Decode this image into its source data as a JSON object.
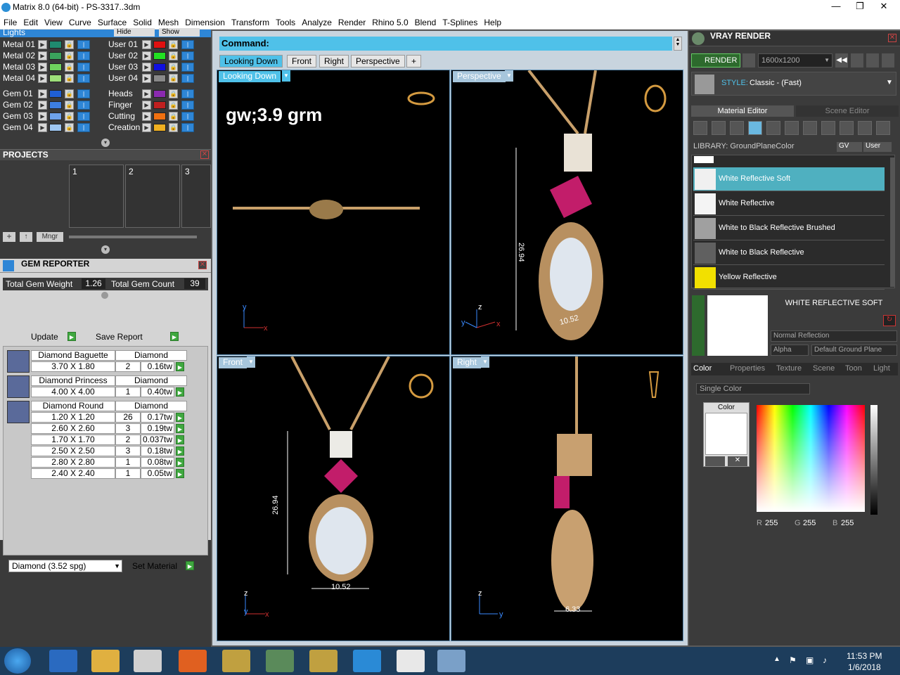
{
  "window": {
    "title": "Matrix 8.0 (64-bit) - PS-3317..3dm",
    "min": "—",
    "max": "❐",
    "close": "✕"
  },
  "menu": [
    "File",
    "Edit",
    "View",
    "Curve",
    "Surface",
    "Solid",
    "Mesh",
    "Dimension",
    "Transform",
    "Tools",
    "Analyze",
    "Render",
    "Rhino 5.0",
    "Blend",
    "T-Splines",
    "Help"
  ],
  "layers": {
    "top_label": "Lights",
    "hide": "Hide",
    "show": "Show",
    "left": [
      {
        "name": "Metal 01",
        "color": "#1f8a6f"
      },
      {
        "name": "Metal 02",
        "color": "#3aa35c"
      },
      {
        "name": "Metal 03",
        "color": "#6fd35e"
      },
      {
        "name": "Metal 04",
        "color": "#9ee07a"
      },
      {
        "name": "Gem 01",
        "color": "#1f5fd6"
      },
      {
        "name": "Gem 02",
        "color": "#3d7ee0"
      },
      {
        "name": "Gem 03",
        "color": "#6ea2ea"
      },
      {
        "name": "Gem 04",
        "color": "#9ec6f2"
      }
    ],
    "right": [
      {
        "name": "User 01",
        "color": "#e01010"
      },
      {
        "name": "User 02",
        "color": "#22e022"
      },
      {
        "name": "User 03",
        "color": "#1010e0"
      },
      {
        "name": "User 04",
        "color": "#888888"
      },
      {
        "name": "Heads",
        "color": "#8a2ab0"
      },
      {
        "name": "Finger",
        "color": "#c02020"
      },
      {
        "name": "Cutting",
        "color": "#f07010"
      },
      {
        "name": "Creation",
        "color": "#f0b020"
      }
    ]
  },
  "projects": {
    "title": "PROJECTS",
    "slots": [
      "1",
      "2",
      "3"
    ],
    "mngr": "Mngr"
  },
  "gem_reporter": {
    "title": "GEM REPORTER",
    "total_weight_label": "Total Gem Weight",
    "total_weight": "1.26",
    "total_count_label": "Total Gem Count",
    "total_count": "39",
    "update": "Update",
    "save": "Save Report",
    "groups": [
      {
        "cut": "Diamond Baguette",
        "mat": "Diamond",
        "rows": [
          [
            "3.70 X 1.80",
            "2",
            "0.16tw"
          ]
        ]
      },
      {
        "cut": "Diamond Princess",
        "mat": "Diamond",
        "rows": [
          [
            "4.00 X 4.00",
            "1",
            "0.40tw"
          ]
        ]
      },
      {
        "cut": "Diamond Round",
        "mat": "Diamond",
        "rows": [
          [
            "1.20 X 1.20",
            "26",
            "0.17tw"
          ],
          [
            "2.60 X 2.60",
            "3",
            "0.19tw"
          ],
          [
            "1.70 X 1.70",
            "2",
            "0.037tw"
          ],
          [
            "2.50 X 2.50",
            "3",
            "0.18tw"
          ],
          [
            "2.80 X 2.80",
            "1",
            "0.08tw"
          ],
          [
            "2.40 X 2.40",
            "1",
            "0.05tw"
          ]
        ]
      }
    ],
    "material_select": "Diamond     (3.52 spg)",
    "set_material": "Set Material"
  },
  "command": {
    "label": "Command:"
  },
  "view_tabs": [
    "Looking Down",
    "Front",
    "Right",
    "Perspective",
    "+"
  ],
  "viewports": {
    "top_left": {
      "label": "Looking Down",
      "note": "gw;3.9 grm"
    },
    "top_right": {
      "label": "Perspective",
      "dim1": "26.94",
      "dim2": "10.52"
    },
    "bottom_left": {
      "label": "Front",
      "dim1": "26.94",
      "dim2": "10.52"
    },
    "bottom_right": {
      "label": "Right",
      "dim1": "6.33"
    }
  },
  "vray": {
    "title": "VRAY RENDER",
    "render": "RENDER",
    "resolution": "1600x1200",
    "style_label": "STYLE:",
    "style": "Classic - (Fast)",
    "tabs": [
      "Material Editor",
      "Scene Editor"
    ],
    "library_label": "LIBRARY: GroundPlaneColor",
    "gv": "GV",
    "user": "User",
    "items": [
      {
        "name": "White Reflective Soft",
        "color": "#f0f0f0",
        "selected": true
      },
      {
        "name": "White Reflective",
        "color": "#f4f4f4"
      },
      {
        "name": "White to Black Reflective Brushed",
        "color": "#a0a0a0"
      },
      {
        "name": "White to Black Reflective",
        "color": "#606060"
      },
      {
        "name": "Yellow Reflective",
        "color": "#f2e000"
      }
    ],
    "selected_title": "WHITE REFLECTIVE SOFT",
    "reflection": "Normal Reflection",
    "alpha": "Alpha",
    "ground": "Default Ground Plane",
    "prop_tabs": [
      "Color",
      "Properties",
      "Texture",
      "Scene",
      "Toon",
      "Light"
    ],
    "single_color": "Single Color",
    "color_label": "Color",
    "r": "255",
    "g": "255",
    "b": "255"
  },
  "taskbar": {
    "time": "11:53 PM",
    "date": "1/6/2018"
  }
}
